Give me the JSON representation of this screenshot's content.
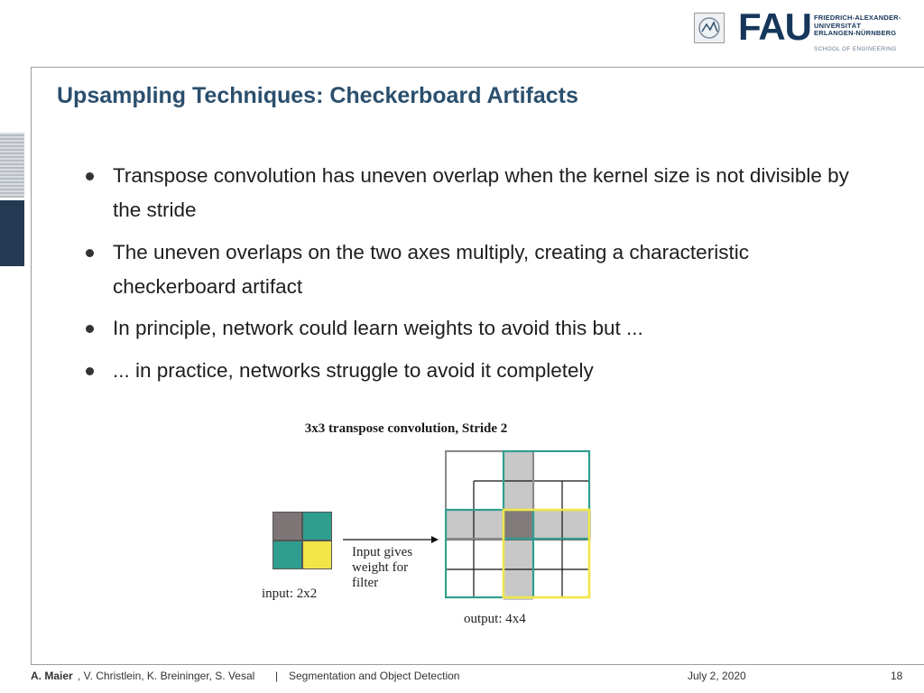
{
  "header": {
    "logo_letters": "FAU",
    "university_name_lines": [
      "FRIEDRICH-ALEXANDER-",
      "UNIVERSITÄT",
      "ERLANGEN-NÜRNBERG"
    ],
    "school": "SCHOOL OF ENGINEERING"
  },
  "slide": {
    "title": "Upsampling Techniques: Checkerboard Artifacts",
    "bullets": [
      "Transpose convolution has uneven overlap when the kernel size is not divisible by the stride",
      "The uneven overlaps on the two axes multiply, creating a characteristic checkerboard artifact",
      "In principle, network could learn weights to avoid this but ...",
      "... in practice, networks struggle to avoid it completely"
    ]
  },
  "figure": {
    "caption": "3x3 transpose convolution, Stride 2",
    "input_label": "input: 2x2",
    "arrow_label": "Input gives weight for filter",
    "output_label": "output: 4x4",
    "colors": {
      "gray_dark": "#7e7576",
      "teal": "#2f9e8f",
      "yellow": "#f0e64a",
      "overlap_light": "#c8c8c8",
      "overlap_dark": "#807a7a"
    }
  },
  "footer": {
    "authors_bold": "A. Maier",
    "authors_rest": ", V. Christlein, K. Breininger, S. Vesal",
    "separator": "|",
    "course": "Segmentation and Object Detection",
    "date": "July 2, 2020",
    "page": "18"
  }
}
